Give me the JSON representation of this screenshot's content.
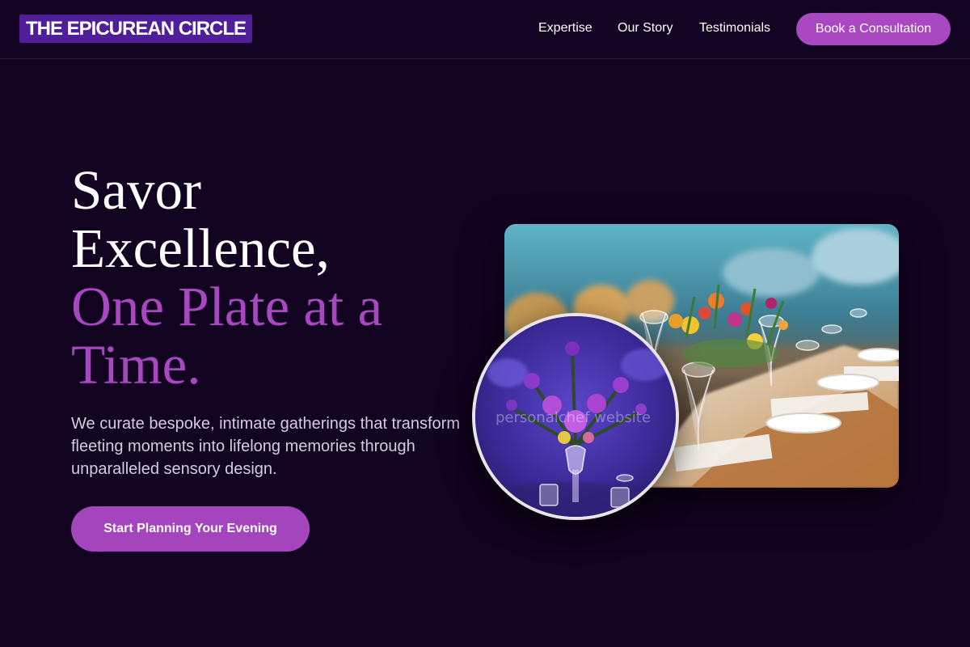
{
  "brand": {
    "logo_text": "THE EPICUREAN CIRCLE"
  },
  "nav": {
    "links": [
      {
        "label": "Expertise"
      },
      {
        "label": "Our Story"
      },
      {
        "label": "Testimonials"
      }
    ],
    "cta_label": "Book a Consultation"
  },
  "hero": {
    "headline_line1": "Savor",
    "headline_line2": "Excellence,",
    "headline_accent_line1": "One Plate at a",
    "headline_accent_line2": "Time.",
    "subtext": "We curate bespoke, intimate gatherings that transform fleeting moments into lifelong memories through unparalleled sensory design.",
    "cta_label": "Start Planning Your Evening"
  },
  "media": {
    "main_photo_subject": "banquet-table-with-flowers",
    "circle_photo_subject": "purple-floral-centerpiece",
    "watermark": "personalchef website"
  },
  "colors": {
    "background": "#120320",
    "accent": "#a848c0",
    "logo_bg": "#4f1f99",
    "text": "#ffffff",
    "muted_text": "#d6cbe0"
  }
}
